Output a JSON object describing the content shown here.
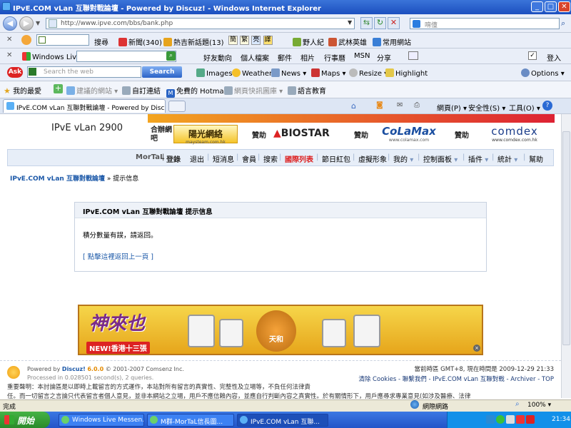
{
  "window": {
    "title": "IPvE.COM vLan 互聯對戰論壇 - Powered by Discuz! - Windows Internet Explorer",
    "min": "_",
    "max": "□",
    "close": "✕"
  },
  "address": {
    "url": "http://www.ipve.com/bbs/bank.php",
    "search_placeholder": "唷僮"
  },
  "bar3": {
    "search_label": "搜尋",
    "news": "新聞(340)",
    "topic": "熱吉新話題(13)",
    "chips": [
      "簡",
      "繁",
      "亮",
      "譯"
    ],
    "s1": "野人紀",
    "s2": "武林英雄",
    "s3": "常用網站"
  },
  "bar4": {
    "live": "Windows Live",
    "items": [
      "好友動向",
      "個人檔案",
      "郵件",
      "相片",
      "行事曆",
      "MSN",
      "分享"
    ],
    "signin": "登入"
  },
  "bar5": {
    "search_placeholder": "Search the web",
    "search_btn": "Search",
    "items": [
      "Images",
      "Weather",
      "News",
      "Maps",
      "Resize",
      "Highlight"
    ],
    "options": "Options"
  },
  "favbar": {
    "fav": "我的最愛",
    "items": [
      "建議的網站",
      "自訂連結",
      "免費的 Hotmail",
      "網頁快訊圖庫",
      "語言教育"
    ]
  },
  "tab": {
    "label": "IPvE.COM vLan 互聯對戰論壇 - Powered by Discuz!"
  },
  "cmdbar": {
    "page": "網頁(P)",
    "safety": "安全性(S)",
    "tools": "工具(O)"
  },
  "site": {
    "title": "IPvE vLan 2900"
  },
  "ads": {
    "co_label": "合辦網吧",
    "sponsor": "贊助",
    "a1": "陽光網絡",
    "a1_sub": "maysteam.com.hk",
    "a2": "BIOSTAR",
    "a3": "CoLaMax",
    "a3_sub": "www.colamax.com",
    "a4": "comdex",
    "a4_sub": "www.comdex.com.hk"
  },
  "nav": {
    "user": "MorTaL",
    "logout_pre": "登錄",
    "items": [
      "退出",
      "短消息",
      "會員",
      "搜索",
      "國際列表",
      "節日紅包",
      "虛擬形象",
      "我的",
      "控制面板",
      "插件",
      "統計",
      "幫助"
    ]
  },
  "breadcrumb": {
    "forum": "IPvE.COM vLan 互聯對戰論壇",
    "sep": "»",
    "current": "提示信息"
  },
  "message": {
    "header": "IPvE.COM vLan 互聯對戰論壇 提示信息",
    "body": "積分數量有誤，請返回。",
    "back": "[ 點擊這裡返回上一頁 ]"
  },
  "banner": {
    "logo": "神來也",
    "badge": "NEW!香港十三張",
    "tile": "天和"
  },
  "footer": {
    "powered": "Powered by",
    "discuz": "Discuz!",
    "version": "6.0.0",
    "copy": "© 2001-2007 Comsenz Inc.",
    "processed": "Processed in 0.028501 second(s), 2 queries.",
    "time": "當前時區 GMT+8, 現在時間是 2009-12-29 21:33",
    "links": "清除 Cookies - 聯繫我們 - IPvE.COM vLan 互聯對戰 - Archiver - TOP",
    "disclaimer": "重要聲明：本討論區是以即時上載留言的方式運作，本站對所有留言的真實性、完整性及立場等，不負任何法律責",
    "disclaimer2": "任。而一切留言之言論只代表留言者個人意見，並非本網站之立場，用戶不應信賴內容，並應自行判斷內容之真實性。於有關情形下，用戶應尋求專業意見(如涉及醫療、法律"
  },
  "status": {
    "left": "完成",
    "zone": "網際網路",
    "zoom": "100%"
  },
  "taskbar": {
    "start": "開始",
    "tasks": [
      "Windows Live Messen...",
      "M群-MorTaL信長圖...",
      "IPvE.COM vLan 互聯..."
    ],
    "lang": "CH",
    "clock": "21:34"
  }
}
